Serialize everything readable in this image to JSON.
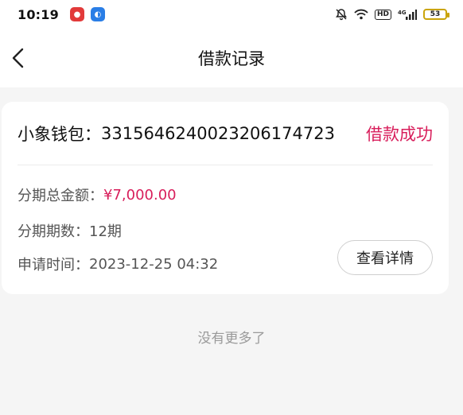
{
  "status_bar": {
    "time": "10:19",
    "network": "4G",
    "battery": "53"
  },
  "nav": {
    "title": "借款记录"
  },
  "record": {
    "wallet_label": "小象钱包：",
    "wallet_id": "3315646240023206174723",
    "status": "借款成功",
    "status_color": "#d81e5b",
    "total_label": "分期总金额：",
    "total_value": "¥7,000.00",
    "periods_label": "分期期数：",
    "periods_value": "12期",
    "time_label": "申请时间：",
    "time_value": "2023-12-25 04:32",
    "detail_button": "查看详情"
  },
  "footer": {
    "no_more": "没有更多了"
  }
}
